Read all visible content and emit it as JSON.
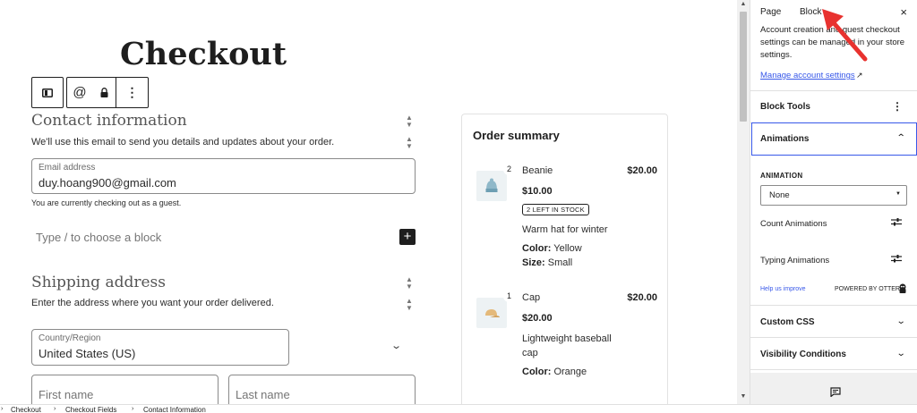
{
  "page": {
    "title": "Checkout"
  },
  "block_toolbar": {
    "transform_icon": "columns-icon",
    "at_symbol": "@",
    "lock_icon": "lock-icon",
    "more_icon": "more-vertical-icon"
  },
  "contact": {
    "title": "Contact information",
    "description": "We'll use this email to send you details and updates about your order.",
    "email_label": "Email address",
    "email_value": "duy.hoang900@gmail.com",
    "guest_note": "You are currently checking out as a guest."
  },
  "inserter": {
    "placeholder": "Type / to choose a block",
    "add_symbol": "+"
  },
  "shipping": {
    "title": "Shipping address",
    "description": "Enter the address where you want your order delivered.",
    "country_label": "Country/Region",
    "country_value": "United States (US)",
    "first_name_placeholder": "First name",
    "last_name_placeholder": "Last name"
  },
  "order_summary": {
    "title": "Order summary",
    "items": [
      {
        "quantity": "2",
        "name": "Beanie",
        "total": "$20.00",
        "price": "$10.00",
        "badge": "2 LEFT IN STOCK",
        "description": "Warm hat for winter",
        "attributes": [
          {
            "label": "Color:",
            "value": "Yellow"
          },
          {
            "label": "Size:",
            "value": "Small"
          }
        ]
      },
      {
        "quantity": "1",
        "name": "Cap",
        "total": "$20.00",
        "price": "$20.00",
        "badge": "",
        "description": "Lightweight baseball cap",
        "attributes": [
          {
            "label": "Color:",
            "value": "Orange"
          }
        ]
      }
    ]
  },
  "sidebar": {
    "tabs": [
      "Page",
      "Block"
    ],
    "active_tab": "Block",
    "close_symbol": "×",
    "account_text": "Account creation and guest checkout settings can be managed in your store settings.",
    "manage_link": "Manage account settings",
    "manage_link_ext": "↗",
    "block_tools": "Block Tools",
    "animations_panel": {
      "title": "Animations",
      "animation_label": "ANIMATION",
      "animation_value": "None",
      "count_animations": "Count Animations",
      "typing_animations": "Typing Animations",
      "help_link": "Help us improve",
      "powered_by": "POWERED BY OTTER"
    },
    "custom_css": "Custom CSS",
    "visibility_conditions": "Visibility Conditions"
  },
  "breadcrumb": [
    "Checkout",
    "Checkout Fields",
    "Contact Information"
  ],
  "colors": {
    "accent": "#3858e9",
    "annotation": "#e8322f"
  }
}
